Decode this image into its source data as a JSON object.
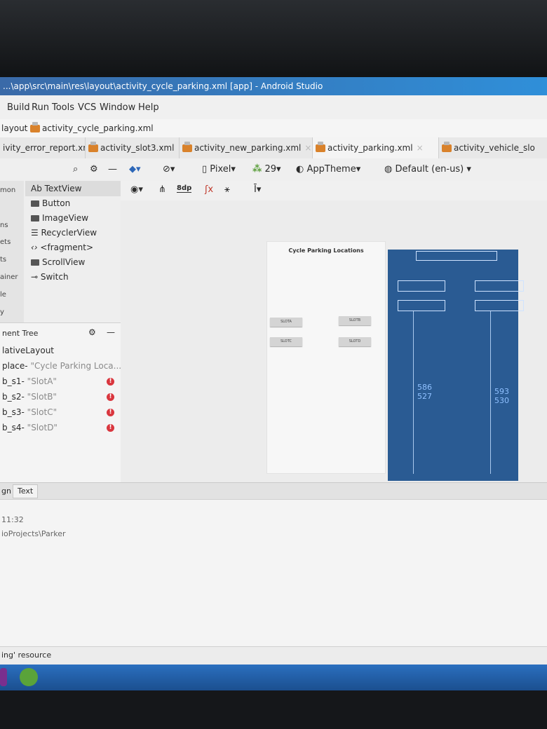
{
  "window": {
    "title": "...\\app\\src\\main\\res\\layout\\activity_cycle_parking.xml [app] - Android Studio"
  },
  "menu": [
    "Build",
    "Run",
    "Tools",
    "VCS",
    "Window",
    "Help"
  ],
  "breadcrumb": {
    "folder": "layout",
    "file": "activity_cycle_parking.xml"
  },
  "tabs": [
    {
      "label": "ivity_error_report.xml"
    },
    {
      "label": "activity_slot3.xml"
    },
    {
      "label": "activity_new_parking.xml"
    },
    {
      "label": "activity_parking.xml"
    },
    {
      "label": "activity_vehicle_slo"
    }
  ],
  "toolbar": {
    "device": "Pixel",
    "api": "29",
    "theme": "AppTheme",
    "locale": "Default (en-us)",
    "margin": "8dp"
  },
  "palette": {
    "categories": [
      "mon",
      "ns",
      "ets",
      "ts",
      "ainer",
      "le",
      "y"
    ],
    "items": [
      "Ab TextView",
      "Button",
      "ImageView",
      "RecyclerView",
      "<fragment>",
      "ScrollView",
      "Switch"
    ]
  },
  "component_tree": {
    "title": "nent Tree",
    "root": "lativeLayout",
    "children": [
      {
        "id": "place",
        "value": "\"Cycle Parking Loca...",
        "error": false
      },
      {
        "id": "b_s1",
        "value": "\"SlotA\"",
        "error": true
      },
      {
        "id": "b_s2",
        "value": "\"SlotB\"",
        "error": true
      },
      {
        "id": "b_s3",
        "value": "\"SlotC\"",
        "error": true
      },
      {
        "id": "b_s4",
        "value": "\"SlotD\"",
        "error": true
      }
    ]
  },
  "design": {
    "title": "Cycle Parking Locations",
    "buttons": [
      "SLOTA",
      "SLOTB",
      "SLOTC",
      "SLOTD"
    ]
  },
  "blueprint": {
    "left_numbers": [
      "586",
      "527"
    ],
    "right_numbers": [
      "593",
      "530"
    ]
  },
  "bottom_tabs": [
    "gn",
    "Text"
  ],
  "log": {
    "time": "11:32",
    "path": "ioProjects\\Parker"
  },
  "status": {
    "text": "ing' resource"
  },
  "colors": {
    "blueprint": "#2a5b93",
    "error": "#d9363e",
    "titlebar": "#2f8fd9"
  }
}
